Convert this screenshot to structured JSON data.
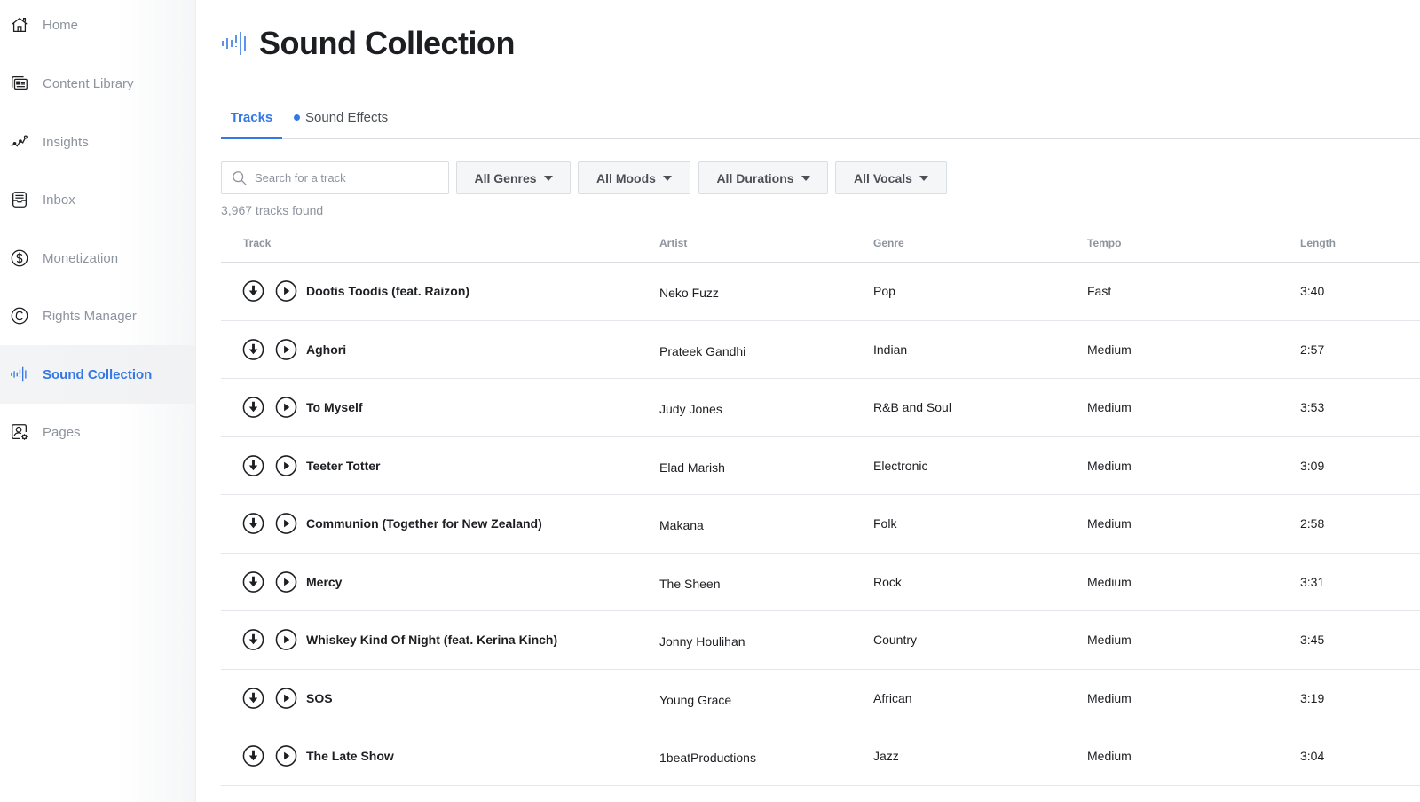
{
  "sidebar": {
    "items": [
      {
        "label": "Home",
        "icon": "home-icon",
        "active": false
      },
      {
        "label": "Content Library",
        "icon": "content-library-icon",
        "active": false
      },
      {
        "label": "Insights",
        "icon": "insights-icon",
        "active": false
      },
      {
        "label": "Inbox",
        "icon": "inbox-icon",
        "active": false
      },
      {
        "label": "Monetization",
        "icon": "dollar-icon",
        "active": false
      },
      {
        "label": "Rights Manager",
        "icon": "copyright-icon",
        "active": false
      },
      {
        "label": "Sound Collection",
        "icon": "soundwave-icon",
        "active": true
      },
      {
        "label": "Pages",
        "icon": "pages-icon",
        "active": false
      }
    ]
  },
  "header": {
    "title": "Sound Collection",
    "icon": "soundwave-icon"
  },
  "tabs": [
    {
      "label": "Tracks",
      "active": true
    },
    {
      "label": "Sound Effects",
      "active": false,
      "badge_dot": true
    }
  ],
  "filters": {
    "search_placeholder": "Search for a track",
    "search_value": "",
    "dropdowns": [
      {
        "label": "All Genres"
      },
      {
        "label": "All Moods"
      },
      {
        "label": "All Durations"
      },
      {
        "label": "All Vocals"
      }
    ]
  },
  "results_count": "3,967 tracks found",
  "table": {
    "columns": [
      "Track",
      "Artist",
      "Genre",
      "Tempo",
      "Length"
    ],
    "rows": [
      {
        "title": "Dootis Toodis (feat. Raizon)",
        "artist": "Neko Fuzz",
        "genre": "Pop",
        "tempo": "Fast",
        "length": "3:40"
      },
      {
        "title": "Aghori",
        "artist": "Prateek Gandhi",
        "genre": "Indian",
        "tempo": "Medium",
        "length": "2:57"
      },
      {
        "title": "To Myself",
        "artist": "Judy Jones",
        "genre": "R&B and Soul",
        "tempo": "Medium",
        "length": "3:53"
      },
      {
        "title": "Teeter Totter",
        "artist": "Elad Marish",
        "genre": "Electronic",
        "tempo": "Medium",
        "length": "3:09"
      },
      {
        "title": "Communion (Together for New Zealand)",
        "artist": "Makana",
        "genre": "Folk",
        "tempo": "Medium",
        "length": "2:58"
      },
      {
        "title": "Mercy",
        "artist": "The Sheen",
        "genre": "Rock",
        "tempo": "Medium",
        "length": "3:31"
      },
      {
        "title": "Whiskey Kind Of Night (feat. Kerina Kinch)",
        "artist": "Jonny Houlihan",
        "genre": "Country",
        "tempo": "Medium",
        "length": "3:45"
      },
      {
        "title": "SOS",
        "artist": "Young Grace",
        "genre": "African",
        "tempo": "Medium",
        "length": "3:19"
      },
      {
        "title": "The Late Show",
        "artist": "1beatProductions",
        "genre": "Jazz",
        "tempo": "Medium",
        "length": "3:04"
      }
    ]
  },
  "colors": {
    "accent": "#3578e5",
    "text_primary": "#1c1e21",
    "text_muted": "#8d949e"
  }
}
